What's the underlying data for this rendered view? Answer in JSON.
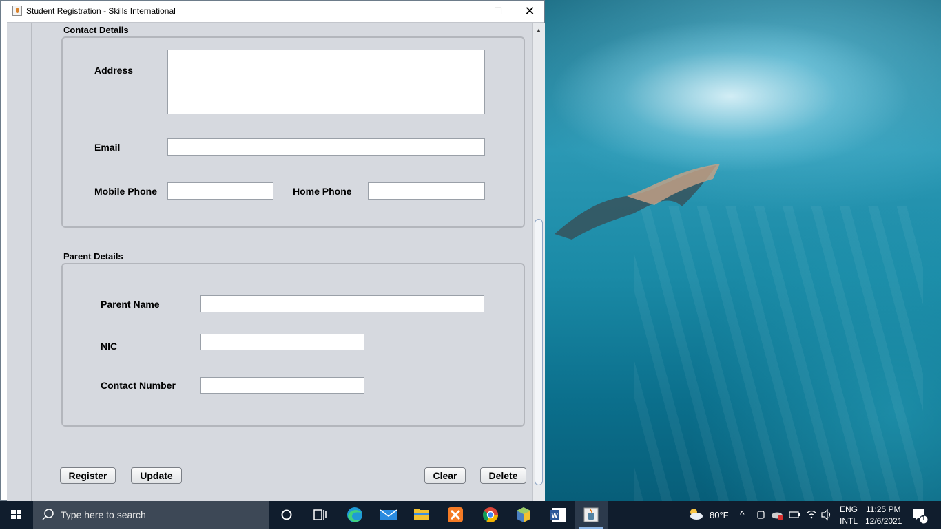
{
  "window": {
    "title": "Student Registration - Skills International",
    "min_glyph": "—",
    "max_glyph": "☐",
    "close_glyph": "✕"
  },
  "contact": {
    "group_title": "Contact Details",
    "address_label": "Address",
    "address_value": "",
    "email_label": "Email",
    "email_value": "",
    "mobile_label": "Mobile Phone",
    "mobile_value": "",
    "home_label": "Home Phone",
    "home_value": ""
  },
  "parent": {
    "group_title": "Parent Details",
    "name_label": "Parent Name",
    "name_value": "",
    "nic_label": "NIC",
    "nic_value": "",
    "contact_label": "Contact Number",
    "contact_value": ""
  },
  "buttons": {
    "register": "Register",
    "update": "Update",
    "clear": "Clear",
    "delete": "Delete"
  },
  "scrollbar": {
    "up_glyph": "▲"
  },
  "taskbar": {
    "search_placeholder": "Type here to search",
    "icons": [
      "windows-start-icon",
      "cortana-icon",
      "task-view-icon",
      "edge-icon",
      "mail-icon",
      "file-explorer-icon",
      "xampp-icon",
      "chrome-icon",
      "virtualbox-icon",
      "word-icon",
      "java-icon"
    ],
    "weather_temp": "80°F",
    "language_top": "ENG",
    "language_bottom": "INTL",
    "time": "11:25 PM",
    "date": "12/6/2021",
    "notification_count": "1"
  },
  "colors": {
    "window_bg": "#d6d9df",
    "taskbar_bg": "#101d2d",
    "accent": "#8fb8e8"
  }
}
